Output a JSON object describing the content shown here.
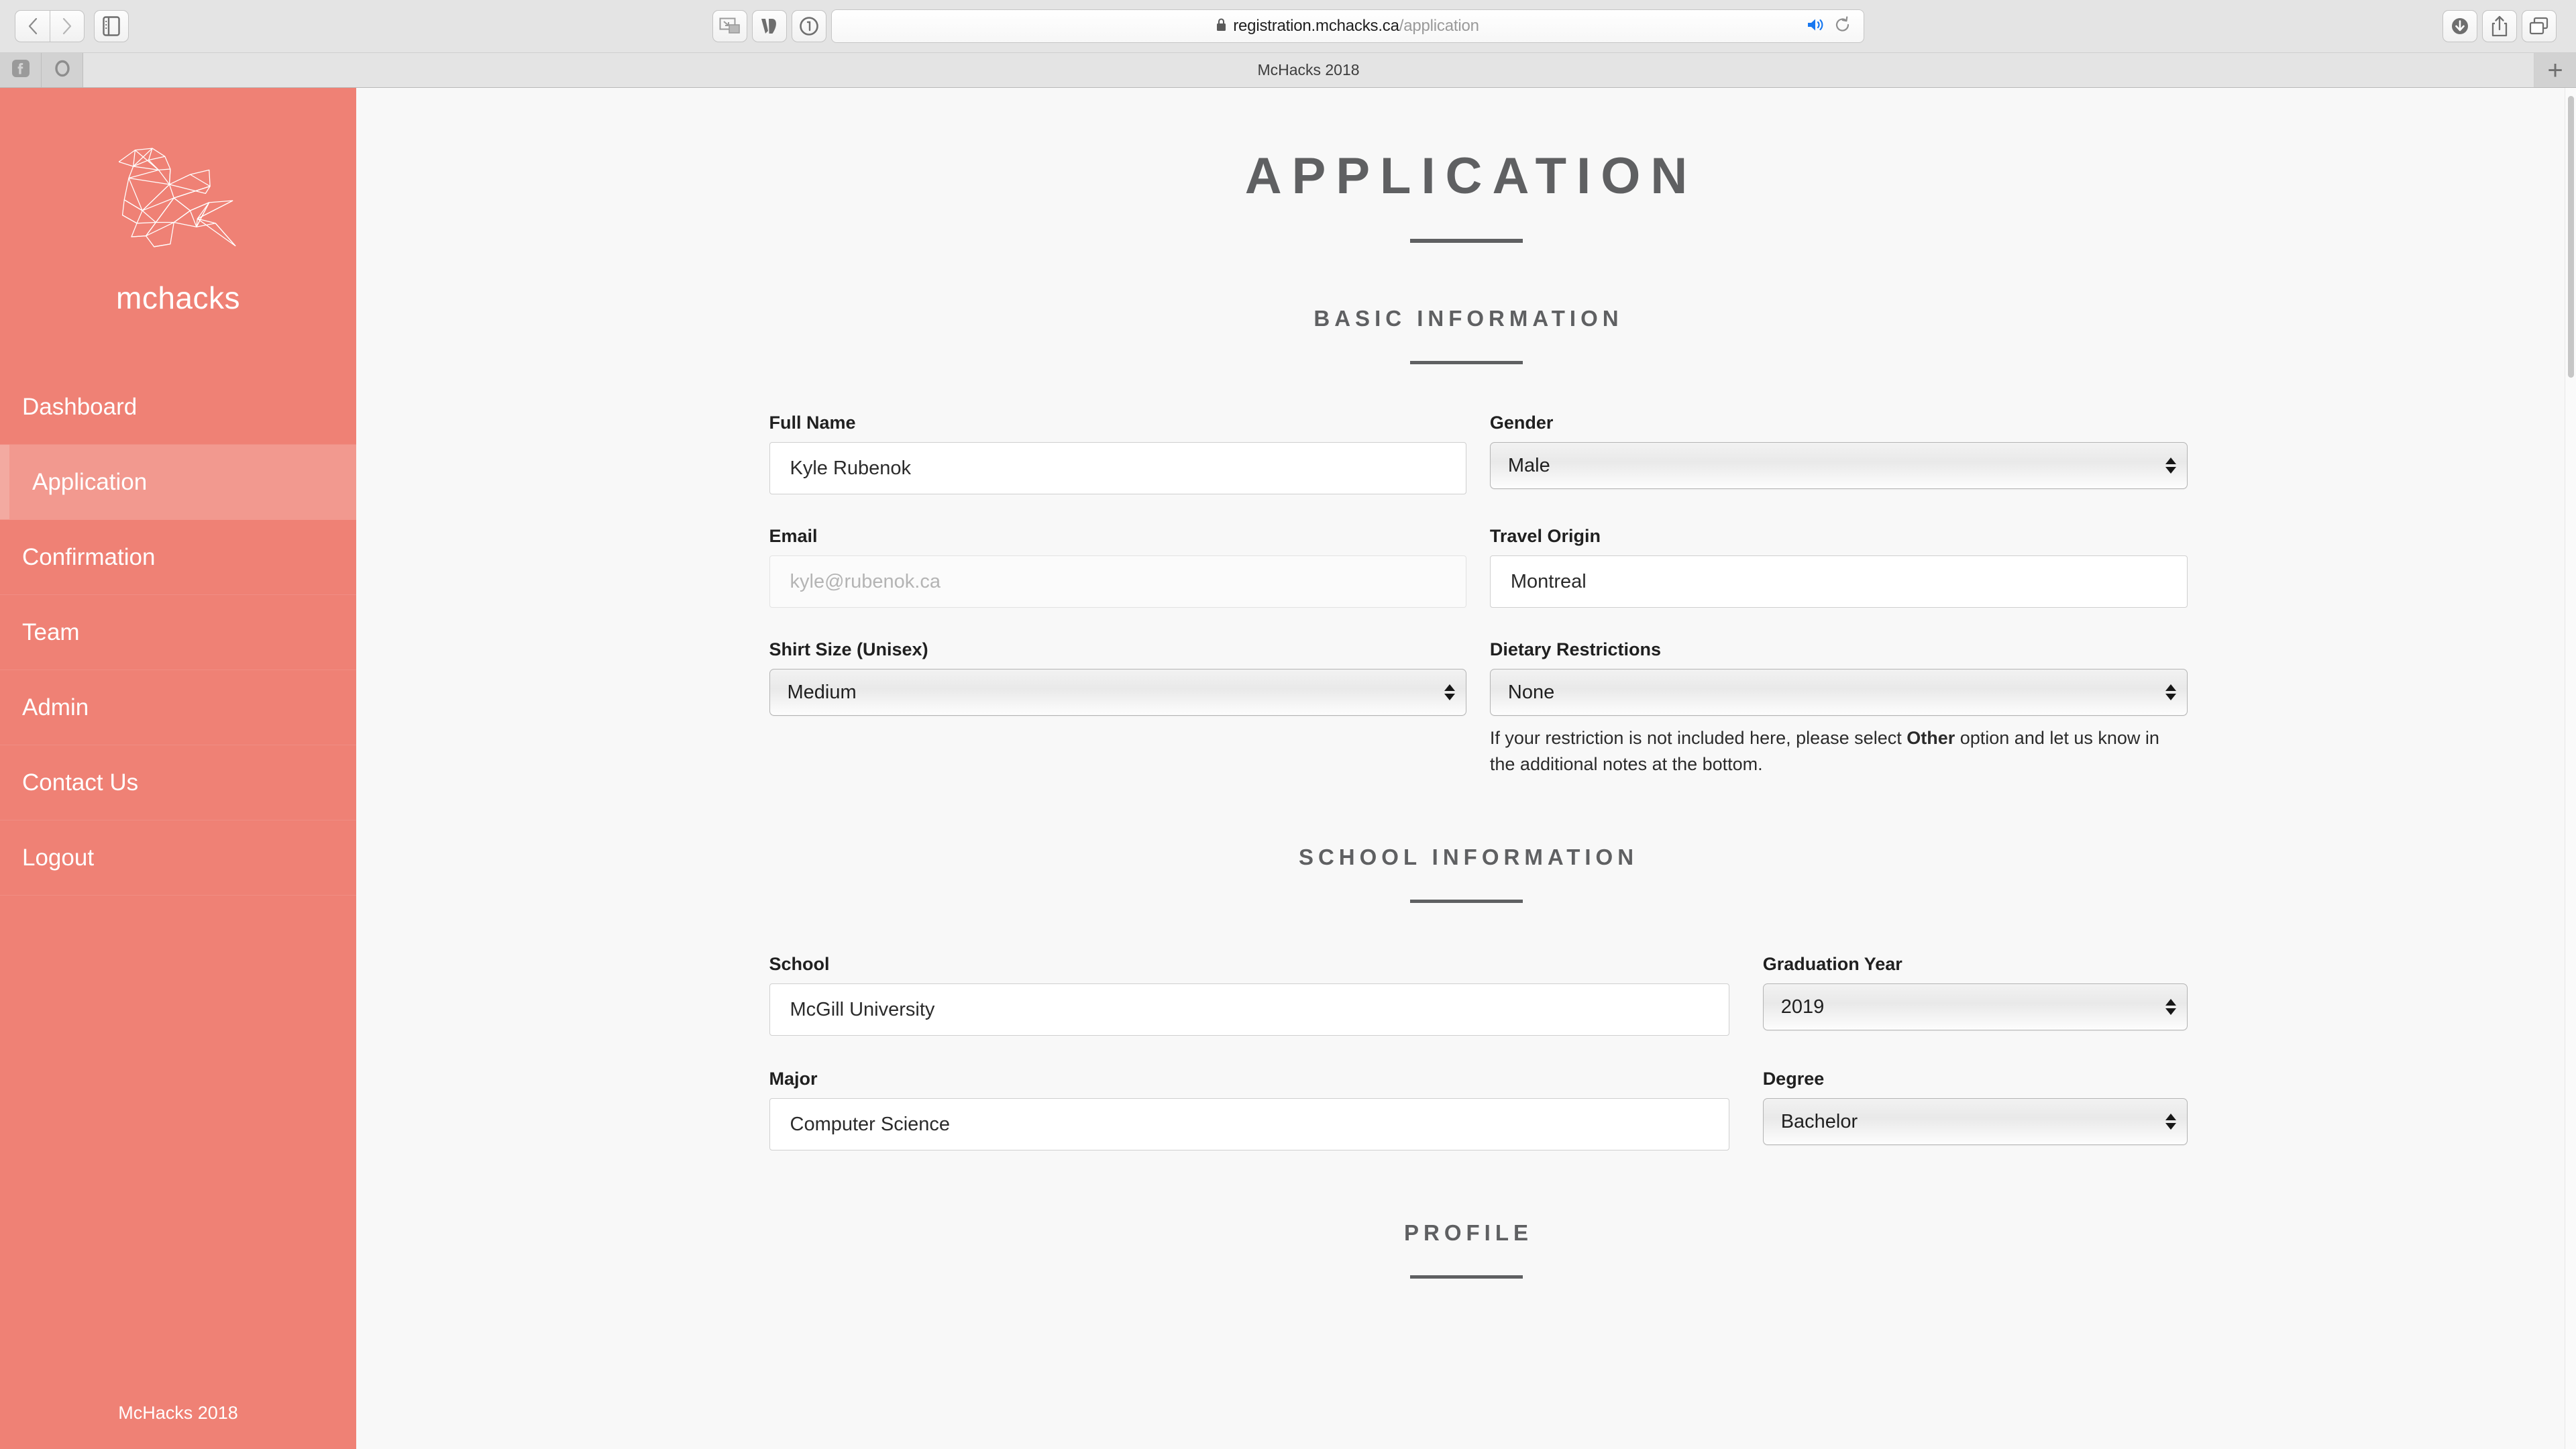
{
  "browser": {
    "back_label": "Back",
    "forward_label": "Forward",
    "sidebar_label": "Show Sidebar",
    "pip_label": "Picture in Picture",
    "extension_label": "VD Extension",
    "password_label": "1Password",
    "downloads_label": "Downloads",
    "share_label": "Share",
    "tab_overview_label": "Tab Overview",
    "url_domain": "registration.mchacks.ca",
    "url_path": "/application",
    "lock_label": "Secure",
    "audio_label": "Audio Playing",
    "reload_label": "Reload",
    "new_tab_label": "+",
    "tabs": [
      {
        "label": "Facebook",
        "icon": "facebook-icon"
      },
      {
        "label": "Opera",
        "icon": "circle-icon"
      }
    ],
    "active_tab_title": "McHacks 2018"
  },
  "sidebar": {
    "brand": "mchacks",
    "logo_icon": "low-poly-bird-logo",
    "items": [
      {
        "label": "Dashboard",
        "active": false
      },
      {
        "label": "Application",
        "active": true
      },
      {
        "label": "Confirmation",
        "active": false
      },
      {
        "label": "Team",
        "active": false
      },
      {
        "label": "Admin",
        "active": false
      },
      {
        "label": "Contact Us",
        "active": false
      },
      {
        "label": "Logout",
        "active": false
      }
    ],
    "footer": "McHacks 2018",
    "accent": "#ef8175",
    "accent_active": "#f2998f"
  },
  "main": {
    "title": "APPLICATION",
    "sections": {
      "basic": {
        "heading": "BASIC INFORMATION",
        "full_name": {
          "label": "Full Name",
          "value": "Kyle Rubenok"
        },
        "gender": {
          "label": "Gender",
          "value": "Male"
        },
        "email": {
          "label": "Email",
          "value": "",
          "placeholder": "kyle@rubenok.ca"
        },
        "travel_origin": {
          "label": "Travel Origin",
          "value": "Montreal"
        },
        "shirt_size": {
          "label": "Shirt Size (Unisex)",
          "value": "Medium"
        },
        "dietary": {
          "label": "Dietary Restrictions",
          "value": "None",
          "help_before": "If your restriction is not included here, please select ",
          "help_bold": "Other",
          "help_after": " option and let us know in the additional notes at the bottom."
        }
      },
      "school": {
        "heading": "SCHOOL INFORMATION",
        "school": {
          "label": "School",
          "value": "McGill University"
        },
        "grad_year": {
          "label": "Graduation Year",
          "value": "2019"
        },
        "major": {
          "label": "Major",
          "value": "Computer Science"
        },
        "degree": {
          "label": "Degree",
          "value": "Bachelor"
        }
      },
      "profile": {
        "heading": "PROFILE"
      }
    }
  }
}
